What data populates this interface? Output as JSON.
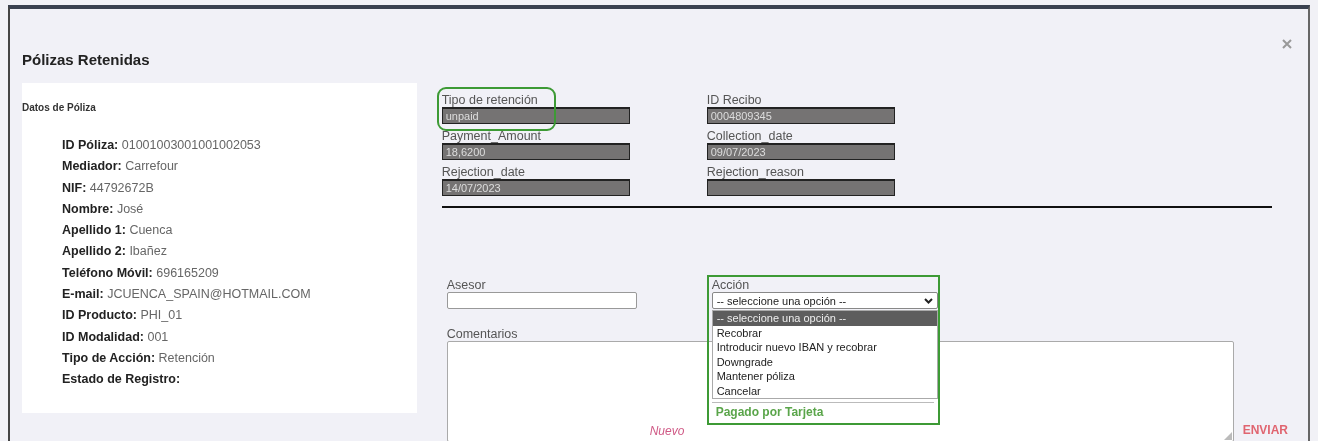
{
  "dialog": {
    "title": "Pólizas Retenidas"
  },
  "policy_panel": {
    "heading": "Datos de Póliza",
    "items": [
      {
        "label": "ID Póliza:",
        "value": "01001003001001002053"
      },
      {
        "label": "Mediador:",
        "value": "Carrefour"
      },
      {
        "label": "NIF:",
        "value": "44792672B"
      },
      {
        "label": "Nombre:",
        "value": "José"
      },
      {
        "label": "Apellido 1:",
        "value": "Cuenca"
      },
      {
        "label": "Apellido 2:",
        "value": "Ibañez"
      },
      {
        "label": "Teléfono Móvil:",
        "value": "696165209"
      },
      {
        "label": "E-mail:",
        "value": "JCUENCA_SPAIN@HOTMAIL.COM"
      },
      {
        "label": "ID Producto:",
        "value": "PHI_01"
      },
      {
        "label": "ID Modalidad:",
        "value": "001"
      },
      {
        "label": "Tipo de Acción:",
        "value": "Retención"
      },
      {
        "label": "Estado de Registro:"
      }
    ]
  },
  "retention_fields": [
    {
      "label": "Tipo de retención",
      "value": "unpaid",
      "highlighted": true
    },
    {
      "label": "ID Recibo",
      "value": "0004809345",
      "highlighted": false
    },
    {
      "label": "Payment_Amount",
      "value": "18,6200",
      "highlighted": false
    },
    {
      "label": "Collection_date",
      "value": "09/07/2023",
      "highlighted": false
    },
    {
      "label": "Rejection_date",
      "value": "14/07/2023",
      "highlighted": false
    },
    {
      "label": "Rejection_reason",
      "highlighted": false
    }
  ],
  "advisor": {
    "label": "Asesor"
  },
  "action": {
    "label": "Acción",
    "value": "-- seleccione una opción --",
    "highlighted": true,
    "expanded": true,
    "options": [
      {
        "label": "-- seleccione una opción --",
        "selected": true
      },
      {
        "label": "Recobrar",
        "selected": false
      },
      {
        "label": "Introducir nuevo IBAN y recobrar",
        "selected": false
      },
      {
        "label": "Downgrade",
        "selected": false
      },
      {
        "label": "Mantener póliza",
        "selected": false
      },
      {
        "label": "Cancelar",
        "selected": false
      }
    ],
    "payment_note": "Pagado por Tarjeta"
  },
  "comments": {
    "label": "Comentarios",
    "new_label": "Nuevo"
  },
  "submit": "ENVIAR"
}
